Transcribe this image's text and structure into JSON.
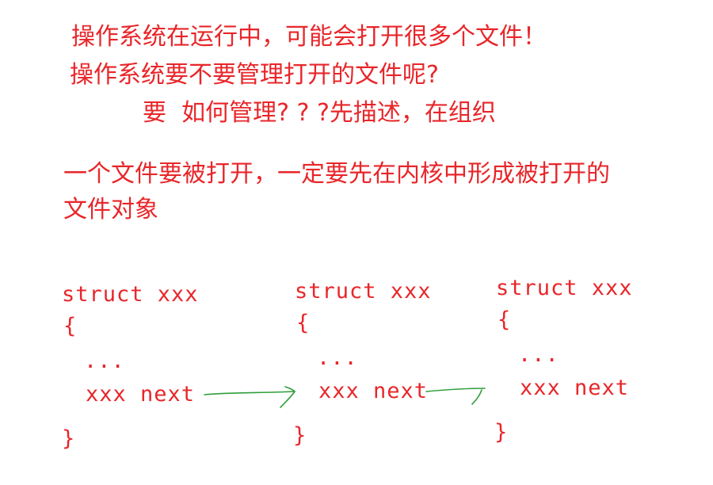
{
  "notes": {
    "line1": "操作系统在运行中，可能会打开很多个文件！",
    "line2": "操作系统要不要管理打开的文件呢?",
    "line3": "要  如何管理? ? ?先描述，在组织",
    "line4": "一个文件要被打开，一定要先在内核中形成被打开的",
    "line5": "文件对象"
  },
  "structs": [
    {
      "header": "struct xxx",
      "open_brace": "{",
      "ellipsis": "...",
      "field": "xxx next",
      "close_brace": "}"
    },
    {
      "header": "struct xxx",
      "open_brace": "{",
      "ellipsis": "...",
      "field": "xxx next",
      "close_brace": "}"
    },
    {
      "header": "struct xxx",
      "open_brace": "{",
      "ellipsis": "...",
      "field": "xxx next",
      "close_brace": "}"
    }
  ],
  "colors": {
    "text": "#e8262a",
    "arrow": "#2e9e3a"
  }
}
